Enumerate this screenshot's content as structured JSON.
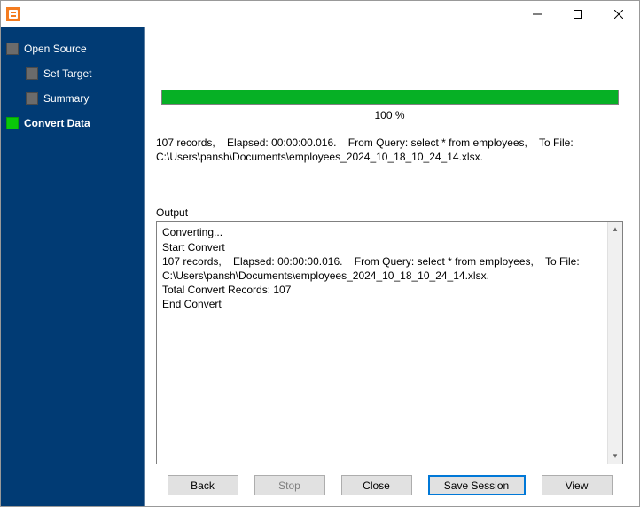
{
  "titlebar": {
    "title": ""
  },
  "sidebar": {
    "items": [
      {
        "label": "Open Source",
        "indent": 0,
        "active": false
      },
      {
        "label": "Set Target",
        "indent": 1,
        "active": false
      },
      {
        "label": "Summary",
        "indent": 1,
        "active": false
      },
      {
        "label": "Convert Data",
        "indent": 0,
        "active": true
      }
    ]
  },
  "progress": {
    "percent": 100,
    "text": "100 %"
  },
  "summary": "107 records,    Elapsed: 00:00:00.016.    From Query: select * from employees,    To File: C:\\Users\\pansh\\Documents\\employees_2024_10_18_10_24_14.xlsx.",
  "output": {
    "label": "Output",
    "lines": [
      "Converting...",
      "Start Convert",
      "107 records,    Elapsed: 00:00:00.016.    From Query: select * from employees,    To File: C:\\Users\\pansh\\Documents\\employees_2024_10_18_10_24_14.xlsx.",
      "Total Convert Records: 107",
      "End Convert"
    ]
  },
  "buttons": {
    "back": "Back",
    "stop": "Stop",
    "close": "Close",
    "save_session": "Save Session",
    "view": "View"
  }
}
